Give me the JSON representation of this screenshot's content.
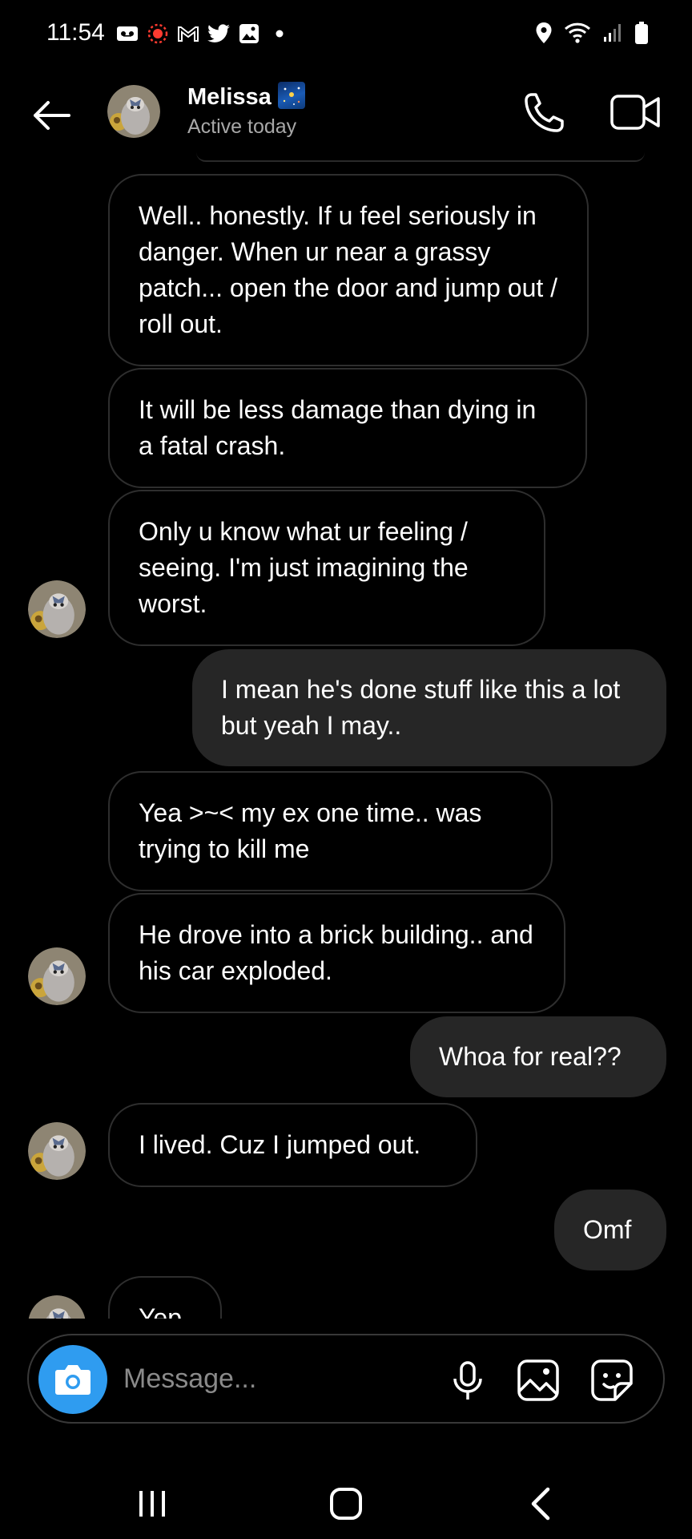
{
  "status_bar": {
    "time": "11:54",
    "left_icons": [
      "voicemail-icon",
      "recording-icon",
      "gmail-icon",
      "twitter-icon",
      "gallery-icon",
      "dot-icon"
    ],
    "right_icons": [
      "location-icon",
      "wifi-icon",
      "signal-icon",
      "battery-icon"
    ]
  },
  "header": {
    "contact_name": "Melissa",
    "contact_emoji": "night-sky-icon",
    "status": "Active today"
  },
  "messages": [
    {
      "from": "them",
      "text": "Well.. honestly. If u feel seriously in danger. When ur near a grassy patch... open the door and jump out / roll out."
    },
    {
      "from": "them",
      "text": "It will be less damage than dying in a fatal crash."
    },
    {
      "from": "them",
      "text": "Only u know what ur feeling / seeing. I'm just imagining the worst."
    },
    {
      "from": "me",
      "text": "I mean he's done stuff like this a lot but yeah I may.."
    },
    {
      "from": "them",
      "text": "Yea >~< my ex one time.. was trying to kill me"
    },
    {
      "from": "them",
      "text": "He drove into a brick building.. and his car exploded."
    },
    {
      "from": "me",
      "text": "Whoa for real??"
    },
    {
      "from": "them",
      "text": "I lived. Cuz I jumped out."
    },
    {
      "from": "me",
      "text": "Omf"
    },
    {
      "from": "them",
      "text": "Yep"
    }
  ],
  "composer": {
    "placeholder": "Message..."
  },
  "colors": {
    "background": "#000000",
    "outgoing_bubble": "#262626",
    "incoming_border": "#2e2e2e",
    "camera_button": "#2f9cf0"
  }
}
